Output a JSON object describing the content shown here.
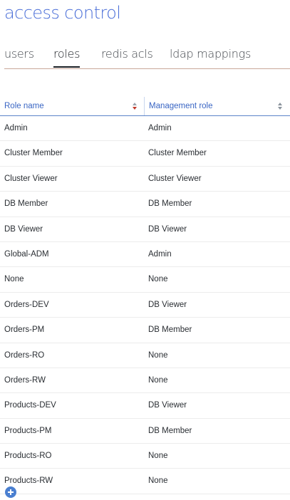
{
  "page": {
    "title": "access control"
  },
  "tabs": [
    {
      "label": "users",
      "active": false
    },
    {
      "label": "roles",
      "active": true
    },
    {
      "label": "redis acls",
      "active": false
    },
    {
      "label": "ldap mappings",
      "active": false
    }
  ],
  "table": {
    "columns": [
      {
        "label": "Role name",
        "sort": "descending"
      },
      {
        "label": "Management role",
        "sort": "none"
      }
    ],
    "rows": [
      {
        "role": "Admin",
        "management": "Admin"
      },
      {
        "role": "Cluster Member",
        "management": "Cluster Member"
      },
      {
        "role": "Cluster Viewer",
        "management": "Cluster Viewer"
      },
      {
        "role": "DB Member",
        "management": "DB Member"
      },
      {
        "role": "DB Viewer",
        "management": "DB Viewer"
      },
      {
        "role": "Global-ADM",
        "management": "Admin"
      },
      {
        "role": "None",
        "management": "None"
      },
      {
        "role": "Orders-DEV",
        "management": "DB Viewer"
      },
      {
        "role": "Orders-PM",
        "management": "DB Member"
      },
      {
        "role": "Orders-RO",
        "management": "None"
      },
      {
        "role": "Orders-RW",
        "management": "None"
      },
      {
        "role": "Products-DEV",
        "management": "DB Viewer"
      },
      {
        "role": "Products-PM",
        "management": "DB Member"
      },
      {
        "role": "Products-RO",
        "management": "None"
      },
      {
        "role": "Products-RW",
        "management": "None"
      }
    ]
  },
  "icons": {
    "sort": "sort-icon",
    "sort_active": "sort-descending-icon",
    "add": "add-icon"
  },
  "colors": {
    "accent": "#4b6fd8",
    "header_text": "#3a66c4",
    "sort_active": "#c0392b",
    "add_button": "#4a7fd0"
  }
}
